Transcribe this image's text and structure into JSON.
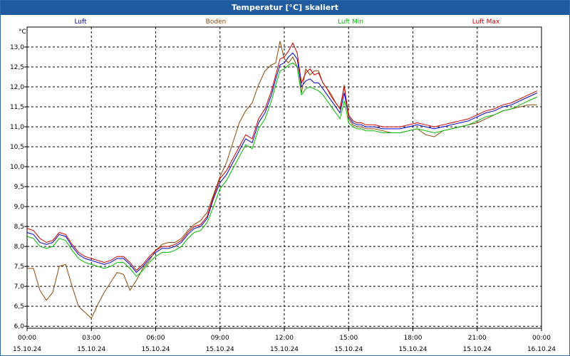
{
  "chart_data": {
    "type": "line",
    "title": "Temperatur [°C] skaliert",
    "ylabel": "°C",
    "ylim": [
      5.95,
      13.5
    ],
    "yticks": [
      6.0,
      6.5,
      7.0,
      7.5,
      8.0,
      8.5,
      9.0,
      9.5,
      10.0,
      10.5,
      11.0,
      11.5,
      12.0,
      12.5,
      13.0
    ],
    "ytick_labels": [
      "6,0",
      "6,5",
      "7,0",
      "7,5",
      "8,0",
      "8,5",
      "9,0",
      "9,5",
      "10,0",
      "10,5",
      "11,0",
      "11,5",
      "12,0",
      "12,5",
      "13,0"
    ],
    "xlim": [
      0,
      24
    ],
    "x_unit": "hours since 15.10.24 00:00",
    "xticks": [
      {
        "time": "00:00",
        "date": "15.10.24"
      },
      {
        "time": "03:00",
        "date": "15.10.24"
      },
      {
        "time": "06:00",
        "date": "15.10.24"
      },
      {
        "time": "09:00",
        "date": "15.10.24"
      },
      {
        "time": "12:00",
        "date": "15.10.24"
      },
      {
        "time": "15:00",
        "date": "15.10.24"
      },
      {
        "time": "18:00",
        "date": "15.10.24"
      },
      {
        "time": "21:00",
        "date": "15.10.24"
      },
      {
        "time": "00:00",
        "date": "16.10.24"
      }
    ],
    "grid": true,
    "legend_position": "top",
    "series": [
      {
        "name": "Luft",
        "color": "#0000cc",
        "x": [
          0,
          0.3,
          0.6,
          0.9,
          1.2,
          1.5,
          1.8,
          2.1,
          2.4,
          2.7,
          3.0,
          3.3,
          3.6,
          3.9,
          4.2,
          4.5,
          4.8,
          5.1,
          5.4,
          5.7,
          6.0,
          6.3,
          6.6,
          6.9,
          7.2,
          7.5,
          7.8,
          8.1,
          8.4,
          8.7,
          9.0,
          9.3,
          9.6,
          9.9,
          10.2,
          10.5,
          10.8,
          11.1,
          11.4,
          11.6,
          11.8,
          12.0,
          12.2,
          12.4,
          12.6,
          12.8,
          13.0,
          13.2,
          13.4,
          13.6,
          13.8,
          14.0,
          14.2,
          14.4,
          14.6,
          14.8,
          15.0,
          15.2,
          15.4,
          15.6,
          15.8,
          16.2,
          16.6,
          17.0,
          17.4,
          17.8,
          18.2,
          18.6,
          19.0,
          19.4,
          19.8,
          20.2,
          20.6,
          21.0,
          21.4,
          21.8,
          22.2,
          22.6,
          23.0,
          23.4,
          23.8
        ],
        "y": [
          8.35,
          8.3,
          8.1,
          8.05,
          8.1,
          8.3,
          8.25,
          8.0,
          7.8,
          7.7,
          7.65,
          7.6,
          7.55,
          7.6,
          7.7,
          7.7,
          7.55,
          7.35,
          7.5,
          7.7,
          7.85,
          7.95,
          7.95,
          8.0,
          8.1,
          8.3,
          8.45,
          8.5,
          8.7,
          9.2,
          9.6,
          9.8,
          10.1,
          10.4,
          10.7,
          10.6,
          11.1,
          11.35,
          11.8,
          12.2,
          12.55,
          12.6,
          12.75,
          12.85,
          12.7,
          12.0,
          12.15,
          12.2,
          12.1,
          12.1,
          11.95,
          11.8,
          11.65,
          11.5,
          11.35,
          11.85,
          11.25,
          11.1,
          11.05,
          11.05,
          11.0,
          11.0,
          10.95,
          10.95,
          10.95,
          11.0,
          11.05,
          11.0,
          10.95,
          11.0,
          11.05,
          11.1,
          11.15,
          11.25,
          11.35,
          11.4,
          11.5,
          11.55,
          11.65,
          11.75,
          11.85
        ]
      },
      {
        "name": "Boden",
        "color": "#8b4a0a",
        "x": [
          0,
          0.3,
          0.6,
          0.9,
          1.2,
          1.5,
          1.8,
          2.1,
          2.4,
          2.7,
          3.0,
          3.3,
          3.6,
          3.9,
          4.2,
          4.5,
          4.8,
          5.1,
          5.4,
          5.7,
          6.0,
          6.3,
          6.6,
          6.9,
          7.2,
          7.5,
          7.8,
          8.1,
          8.4,
          8.7,
          9.0,
          9.3,
          9.6,
          9.9,
          10.2,
          10.5,
          10.8,
          11.1,
          11.4,
          11.6,
          11.8,
          12.0,
          12.2,
          12.4,
          12.6,
          12.8,
          13.0,
          13.2,
          13.4,
          13.6,
          13.8,
          14.0,
          14.2,
          14.4,
          14.6,
          14.8,
          15.0,
          15.2,
          15.4,
          15.6,
          15.8,
          16.2,
          16.6,
          17.0,
          17.4,
          17.8,
          18.2,
          18.6,
          19.0,
          19.4,
          19.8,
          20.2,
          20.6,
          21.0,
          21.4,
          21.8,
          22.2,
          22.6,
          23.0,
          23.4,
          23.8
        ],
        "y": [
          7.45,
          7.45,
          6.9,
          6.65,
          6.85,
          7.5,
          7.55,
          7.0,
          6.5,
          6.35,
          6.2,
          6.55,
          6.85,
          7.1,
          7.35,
          7.3,
          6.9,
          7.15,
          7.45,
          7.65,
          7.9,
          8.05,
          8.1,
          8.1,
          8.2,
          8.4,
          8.55,
          8.65,
          8.85,
          9.3,
          9.75,
          10.1,
          10.6,
          11.1,
          11.4,
          11.6,
          12.05,
          12.4,
          12.55,
          12.6,
          13.15,
          12.7,
          12.6,
          12.75,
          12.5,
          11.85,
          12.45,
          12.3,
          12.4,
          12.4,
          12.1,
          11.95,
          11.8,
          11.6,
          11.45,
          12.05,
          11.2,
          11.05,
          11.0,
          11.0,
          10.95,
          10.95,
          10.9,
          10.85,
          10.85,
          10.9,
          10.95,
          10.8,
          10.75,
          10.9,
          10.95,
          11.0,
          11.05,
          11.1,
          11.2,
          11.3,
          11.4,
          11.45,
          11.5,
          11.55,
          11.55
        ]
      },
      {
        "name": "Luft Min",
        "color": "#00bb00",
        "x": [
          0,
          0.3,
          0.6,
          0.9,
          1.2,
          1.5,
          1.8,
          2.1,
          2.4,
          2.7,
          3.0,
          3.3,
          3.6,
          3.9,
          4.2,
          4.5,
          4.8,
          5.1,
          5.4,
          5.7,
          6.0,
          6.3,
          6.6,
          6.9,
          7.2,
          7.5,
          7.8,
          8.1,
          8.4,
          8.7,
          9.0,
          9.3,
          9.6,
          9.9,
          10.2,
          10.5,
          10.8,
          11.1,
          11.4,
          11.6,
          11.8,
          12.0,
          12.2,
          12.4,
          12.6,
          12.8,
          13.0,
          13.2,
          13.4,
          13.6,
          13.8,
          14.0,
          14.2,
          14.4,
          14.6,
          14.8,
          15.0,
          15.2,
          15.4,
          15.6,
          15.8,
          16.2,
          16.6,
          17.0,
          17.4,
          17.8,
          18.2,
          18.6,
          19.0,
          19.4,
          19.8,
          20.2,
          20.6,
          21.0,
          21.4,
          21.8,
          22.2,
          22.6,
          23.0,
          23.4,
          23.8
        ],
        "y": [
          8.25,
          8.2,
          8.0,
          7.95,
          8.0,
          8.2,
          8.15,
          7.9,
          7.7,
          7.6,
          7.55,
          7.5,
          7.45,
          7.5,
          7.6,
          7.6,
          7.45,
          7.25,
          7.4,
          7.6,
          7.75,
          7.85,
          7.85,
          7.9,
          8.0,
          8.2,
          8.35,
          8.4,
          8.6,
          9.0,
          9.45,
          9.65,
          9.95,
          10.25,
          10.55,
          10.45,
          10.95,
          11.2,
          11.65,
          12.05,
          12.4,
          12.45,
          12.55,
          12.6,
          12.5,
          11.8,
          11.95,
          12.0,
          11.95,
          11.9,
          11.8,
          11.65,
          11.5,
          11.35,
          11.2,
          11.65,
          11.1,
          11.0,
          10.95,
          10.95,
          10.9,
          10.9,
          10.85,
          10.85,
          10.85,
          10.9,
          10.95,
          10.9,
          10.85,
          10.9,
          10.95,
          11.0,
          11.05,
          11.15,
          11.25,
          11.3,
          11.4,
          11.45,
          11.55,
          11.65,
          11.75
        ]
      },
      {
        "name": "Luft Max",
        "color": "#cc0000",
        "x": [
          0,
          0.3,
          0.6,
          0.9,
          1.2,
          1.5,
          1.8,
          2.1,
          2.4,
          2.7,
          3.0,
          3.3,
          3.6,
          3.9,
          4.2,
          4.5,
          4.8,
          5.1,
          5.4,
          5.7,
          6.0,
          6.3,
          6.6,
          6.9,
          7.2,
          7.5,
          7.8,
          8.1,
          8.4,
          8.7,
          9.0,
          9.3,
          9.6,
          9.9,
          10.2,
          10.5,
          10.8,
          11.1,
          11.4,
          11.6,
          11.8,
          12.0,
          12.2,
          12.4,
          12.6,
          12.8,
          13.0,
          13.2,
          13.4,
          13.6,
          13.8,
          14.0,
          14.2,
          14.4,
          14.6,
          14.8,
          15.0,
          15.2,
          15.4,
          15.6,
          15.8,
          16.2,
          16.6,
          17.0,
          17.4,
          17.8,
          18.2,
          18.6,
          19.0,
          19.4,
          19.8,
          20.2,
          20.6,
          21.0,
          21.4,
          21.8,
          22.2,
          22.6,
          23.0,
          23.4,
          23.8
        ],
        "y": [
          8.45,
          8.4,
          8.2,
          8.1,
          8.15,
          8.35,
          8.3,
          8.05,
          7.85,
          7.75,
          7.7,
          7.65,
          7.6,
          7.65,
          7.75,
          7.75,
          7.6,
          7.4,
          7.55,
          7.75,
          7.9,
          8.0,
          8.0,
          8.05,
          8.15,
          8.35,
          8.5,
          8.55,
          8.75,
          9.25,
          9.7,
          9.9,
          10.2,
          10.5,
          10.8,
          10.7,
          11.2,
          11.45,
          11.9,
          12.3,
          12.7,
          12.75,
          12.9,
          13.1,
          12.85,
          12.1,
          12.35,
          12.45,
          12.3,
          12.35,
          12.1,
          11.95,
          11.75,
          11.6,
          11.45,
          12.0,
          11.3,
          11.15,
          11.1,
          11.1,
          11.05,
          11.05,
          11.0,
          11.0,
          11.0,
          11.05,
          11.1,
          11.05,
          11.0,
          11.05,
          11.1,
          11.15,
          11.2,
          11.3,
          11.4,
          11.45,
          11.55,
          11.6,
          11.7,
          11.8,
          11.9
        ]
      }
    ]
  }
}
